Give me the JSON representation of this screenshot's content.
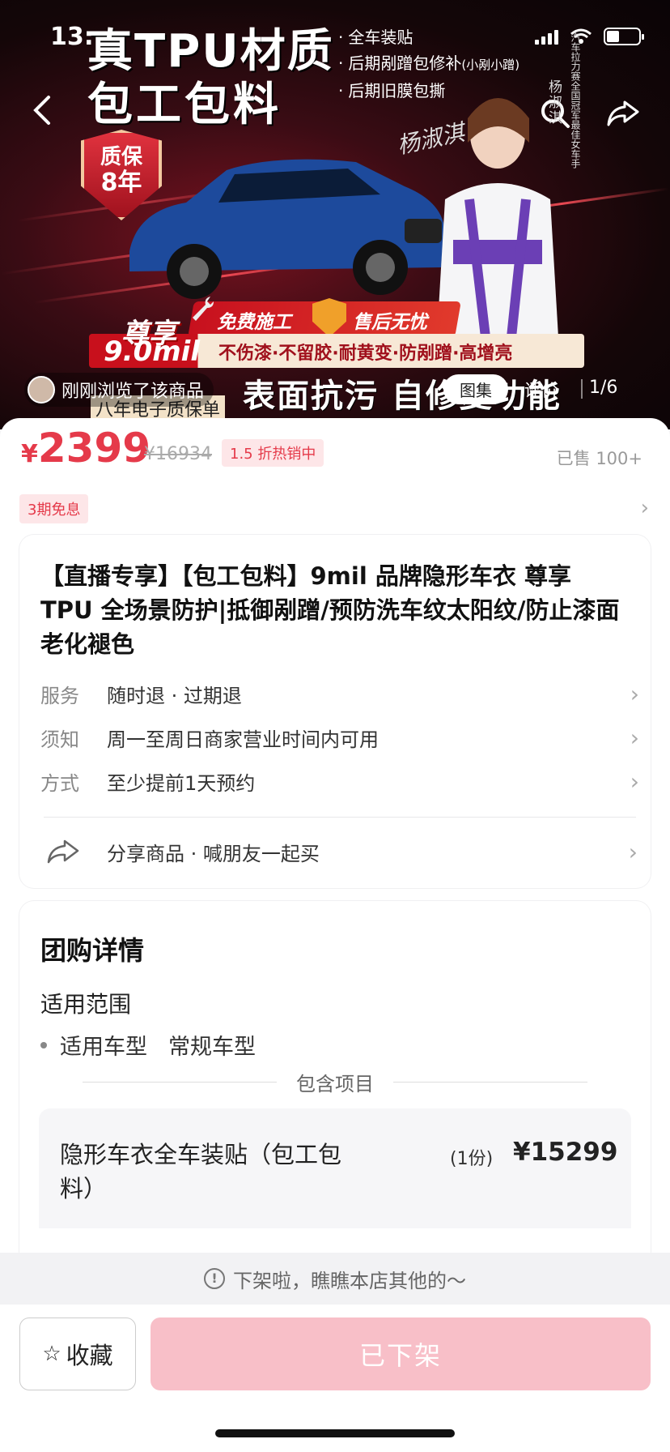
{
  "status_bar": {
    "time": "13:"
  },
  "banner": {
    "headline_line1": "真TPU材质",
    "headline_line2": "包工包料",
    "bullets": [
      {
        "text": "全车装贴",
        "note": ""
      },
      {
        "text": "后期剐蹭包修补",
        "note": "(小剐小蹭)"
      },
      {
        "text": "后期旧膜包撕",
        "note": ""
      }
    ],
    "warranty_badge": [
      "质保",
      "8年"
    ],
    "signature": "杨淑淇",
    "vertical_name": "杨淑淇",
    "vertical_title": "汽车拉力赛全国冠军最佳女车手",
    "promo_free_install": "免费施工",
    "promo_after_sales": "售后无忧",
    "enjoy": "尊享",
    "mil": "9.0mil",
    "features": "不伤漆·不留胶·耐黄变·防剐蹭·高增亮",
    "surface_text": "表面抗污 自修复功能",
    "eight_year": "八年电子质保单",
    "browsed": "刚刚浏览了该商品",
    "tabs": [
      "图集",
      "评价"
    ],
    "counter": "1/6"
  },
  "pricing": {
    "currency": "¥",
    "price": "2399",
    "original_price": "¥16934",
    "discount": "1.5 折热销中",
    "sold": "已售 100+",
    "installment": "3期免息"
  },
  "product": {
    "title": "【直播专享】【包工包料】9mil 品牌隐形车衣 尊享 TPU 全场景防护|抵御剐蹭/预防洗车纹太阳纹/防止漆面老化褪色",
    "rows": [
      {
        "label": "服务",
        "value": "随时退 · 过期退"
      },
      {
        "label": "须知",
        "value": "周一至周日商家营业时间内可用"
      },
      {
        "label": "方式",
        "value": "至少提前1天预约"
      }
    ],
    "share": "分享商品 · 喊朋友一起买"
  },
  "details": {
    "title": "团购详情",
    "scope_title": "适用范围",
    "scope_key": "适用车型",
    "scope_value": "常规车型",
    "included_title": "包含项目",
    "item_name": "隐形车衣全车装贴（包工包料）",
    "item_qty": "(1份)",
    "item_price": "¥15299"
  },
  "notice": "下架啦，瞧瞧本店其他的～",
  "bottom": {
    "favorite": "收藏",
    "status_button": "已下架"
  },
  "colors": {
    "accent": "#e53a4a",
    "disabled_button": "#f8bfc8"
  }
}
